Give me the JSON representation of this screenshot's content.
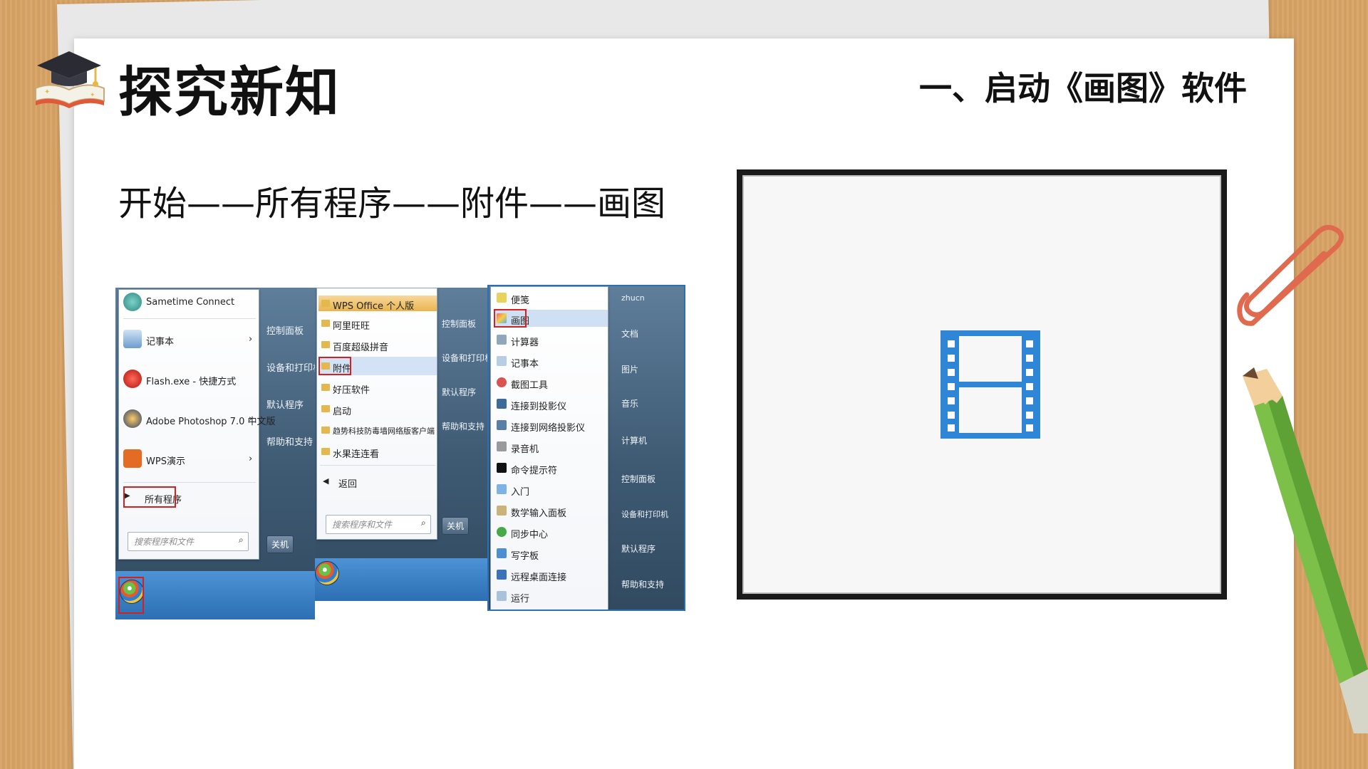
{
  "header": {
    "title": "探究新知",
    "section": "一、启动《画图》软件"
  },
  "instruction": "开始——所有程序——附件——画图",
  "start_menu": {
    "items": [
      {
        "label": "Sametime Connect"
      },
      {
        "label": "记事本",
        "arrow": "›"
      },
      {
        "label": "Flash.exe - 快捷方式"
      },
      {
        "label": "Adobe Photoshop 7.0 中文版",
        "arrow": "›"
      },
      {
        "label": "WPS演示",
        "arrow": "›"
      }
    ],
    "all_programs": "所有程序",
    "search_placeholder": "搜索程序和文件",
    "shutdown": "关机",
    "right_pane": [
      "控制面板",
      "设备和打印机",
      "默认程序",
      "帮助和支持"
    ]
  },
  "programs_menu": {
    "items": [
      "WPS Office 个人版",
      "阿里旺旺",
      "百度超级拼音",
      "附件",
      "好压软件",
      "启动",
      "趋势科技防毒墙网络版客户端",
      "水果连连看"
    ],
    "back": "返回",
    "search_placeholder": "搜索程序和文件",
    "shutdown": "关机",
    "right_pane": [
      "控制面板",
      "设备和打印机",
      "默认程序",
      "帮助和支持"
    ]
  },
  "accessories_menu": {
    "items": [
      "便笺",
      "画图",
      "计算器",
      "记事本",
      "截图工具",
      "连接到投影仪",
      "连接到网络投影仪",
      "录音机",
      "命令提示符",
      "入门",
      "数学输入面板",
      "同步中心",
      "写字板",
      "远程桌面连接",
      "运行"
    ],
    "right_pane": [
      "zhucn",
      "文档",
      "图片",
      "音乐",
      "计算机",
      "控制面板",
      "设备和打印机",
      "默认程序",
      "帮助和支持"
    ]
  },
  "colors": {
    "accent_red": "#d42020",
    "film_blue": "#2f86d6",
    "desk": "#d9a466"
  }
}
